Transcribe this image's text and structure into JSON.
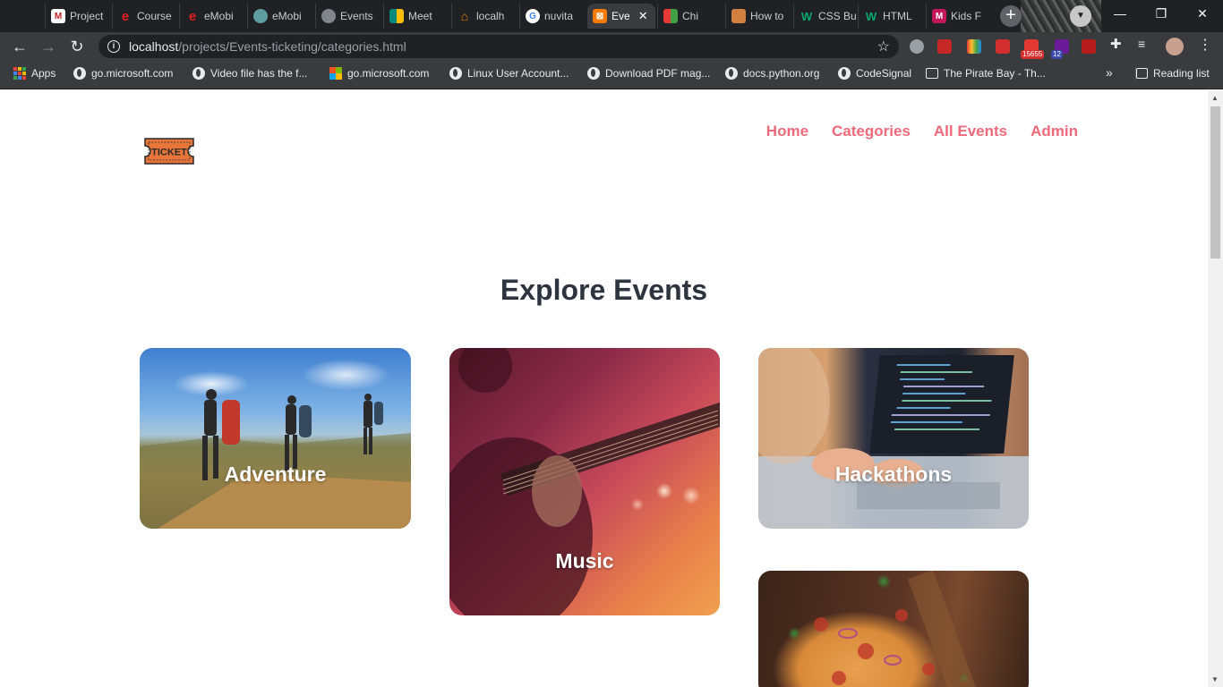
{
  "browser": {
    "tabs": [
      {
        "label": "Project",
        "icon": "gmail-icon",
        "color": "#c5221f"
      },
      {
        "label": "Course",
        "icon": "e-icon",
        "color": "#e02020"
      },
      {
        "label": "eMobi",
        "icon": "e-icon",
        "color": "#e02020"
      },
      {
        "label": "eMobi",
        "icon": "globe-icon",
        "color": "#5f9ea0"
      },
      {
        "label": "Events",
        "icon": "globe-icon",
        "color": "#80868b"
      },
      {
        "label": "Meet",
        "icon": "meet-icon",
        "color": "#00897b"
      },
      {
        "label": "localh",
        "icon": "xampp-icon",
        "color": "#f57c00"
      },
      {
        "label": "nuvita",
        "icon": "google-icon",
        "color": "#4285f4"
      },
      {
        "label": "Eve",
        "icon": "xampp-icon",
        "color": "#f57c00"
      },
      {
        "label": "Chi",
        "icon": "cn-icon",
        "color": "#e53935"
      },
      {
        "label": "How to",
        "icon": "bookmark-icon",
        "color": "#d08040"
      },
      {
        "label": "CSS Bu",
        "icon": "w3-icon",
        "color": "#04aa6d"
      },
      {
        "label": "HTML",
        "icon": "w3-icon",
        "color": "#04aa6d"
      },
      {
        "label": "Kids F",
        "icon": "m-icon",
        "color": "#c2185b"
      }
    ],
    "active_tab_index": 8,
    "url_host": "localhost",
    "url_path": "/projects/Events-ticketing/categories.html",
    "extensions_badges": {
      "mail": "15655",
      "shield": "12"
    },
    "bookmarks": [
      {
        "label": "Apps",
        "icon": "apps-grid-icon"
      },
      {
        "label": "go.microsoft.com",
        "icon": "globe-icon"
      },
      {
        "label": "Video file has the f...",
        "icon": "globe-icon"
      },
      {
        "label": "go.microsoft.com",
        "icon": "microsoft-icon"
      },
      {
        "label": "Linux User Account...",
        "icon": "globe-icon"
      },
      {
        "label": "Download PDF mag...",
        "icon": "globe-icon"
      },
      {
        "label": "docs.python.org",
        "icon": "globe-icon"
      },
      {
        "label": "CodeSignal",
        "icon": "globe-icon"
      },
      {
        "label": "The Pirate Bay - Th...",
        "icon": "computer-icon"
      }
    ],
    "bookmarks_overflow": "»",
    "reading_list": "Reading list"
  },
  "site": {
    "logo_text": "TICKET",
    "nav": [
      {
        "label": "Home"
      },
      {
        "label": "Categories"
      },
      {
        "label": "All Events"
      },
      {
        "label": "Admin"
      }
    ],
    "nav_color": "#ee6a7a",
    "heading": "Explore Events",
    "categories": [
      {
        "label": "Adventure"
      },
      {
        "label": "Music"
      },
      {
        "label": "Hackathons"
      },
      {
        "label": ""
      }
    ]
  }
}
